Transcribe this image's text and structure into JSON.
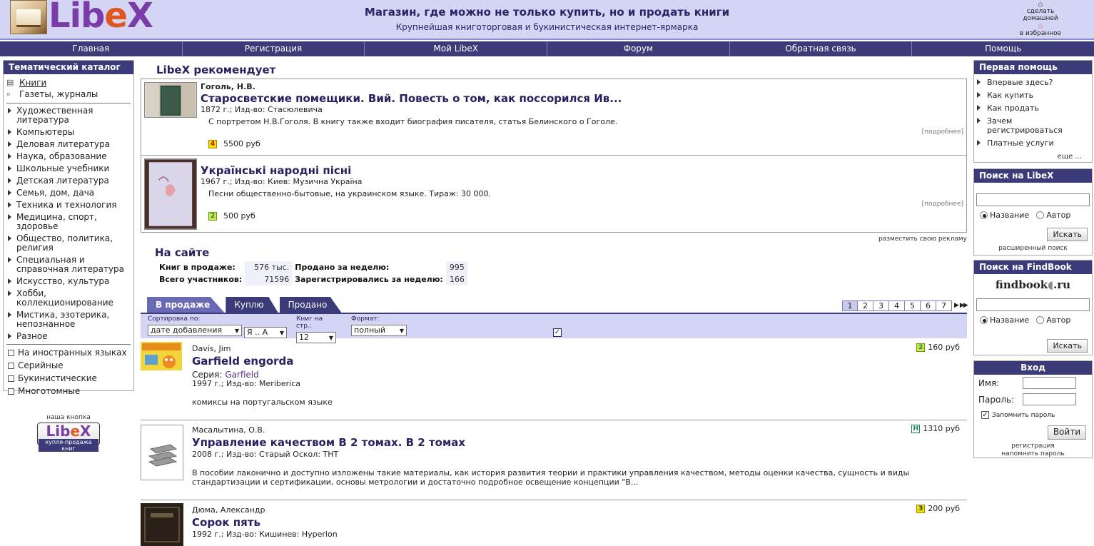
{
  "header": {
    "logo_text": "LibeX",
    "slogan_main": "Магазин, где можно не только купить, но и продать книги",
    "slogan_sub": "Крупнейшая книготорговая и букинистическая интернет-ярмарка",
    "make_home_line1": "сделать",
    "make_home_line2": "домашней",
    "favorites": "в избранное"
  },
  "nav": [
    "Главная",
    "Регистрация",
    "Мой LibeX",
    "Форум",
    "Обратная связь",
    "Помощь"
  ],
  "catalog": {
    "title": "Тематический каталог",
    "top_items": [
      {
        "label": "Книги",
        "icon": "book-icon",
        "selected": true
      },
      {
        "label": "Газеты, журналы",
        "icon": "paperclip-icon",
        "selected": false
      }
    ],
    "categories": [
      "Художественная литература",
      "Компьютеры",
      "Деловая литература",
      "Наука, образование",
      "Школьные учебники",
      "Детская литература",
      "Семья, дом, дача",
      "Техника и технология",
      "Медицина, спорт, здоровье",
      "Общество, политика, религия",
      "Специальная и справочная литература",
      "Искусство, культура",
      "Хобби, коллекционирование",
      "Мистика, эзотерика, непознанное",
      "Разное"
    ],
    "filters": [
      "На иностранных языках",
      "Серийные",
      "Букинистические",
      "Многотомные"
    ]
  },
  "our_button": {
    "caption": "наша кнопка",
    "logo": "LibeX",
    "tagline": "купля-продажа книг"
  },
  "recommend": {
    "title": "LibeX рекомендует",
    "items": [
      {
        "author": "Гоголь, Н.В.",
        "title": "Старосветские помещики. Вий. Повесть о том, как поссорился Ив...",
        "meta": "1872 г.; Изд-во: Стасюлевича",
        "desc": "С портретом Н.В.Гоголя. В книгу также входит биография писателя, статья Белинского о Гоголе.",
        "more": "[подробнее]",
        "grade": "4",
        "price": "5500 руб"
      },
      {
        "author": "",
        "title": "Українські народні пісні",
        "meta": "1967 г.; Изд-во: Киев: Музична Україна",
        "desc": "Песни общественно-бытовые, на украинском языке. Тираж: 30 000.",
        "more": "[подробнее]",
        "grade": "2",
        "price": "500 руб"
      }
    ],
    "ad_link": "разместить свою рекламу"
  },
  "site_stats": {
    "title": "На сайте",
    "rows": [
      {
        "label1": "Книг в продаже:",
        "value1": "576 тыс.",
        "label2": "Продано за неделю:",
        "value2": "995"
      },
      {
        "label1": "Всего участников:",
        "value1": "71596",
        "label2": "Зарегистрировались за неделю:",
        "value2": "166"
      }
    ]
  },
  "tabs": [
    {
      "label": "В продаже",
      "active": true
    },
    {
      "label": "Куплю",
      "active": false
    },
    {
      "label": "Продано",
      "active": false
    }
  ],
  "pager": {
    "pages": [
      "1",
      "2",
      "3",
      "4",
      "5",
      "6",
      "7"
    ],
    "current": "1"
  },
  "sort": {
    "sort_label": "Сортировка по:",
    "sort_value": "дате добавления",
    "order_value": "Я .. А",
    "perpage_label": "Книг на стр.:",
    "perpage_value": "12",
    "format_label": "Формат:",
    "format_value": "полный"
  },
  "listings": [
    {
      "author": "Davis, Jim",
      "title": "Garfield engorda",
      "series_label": "Серия: ",
      "series": "Garfield",
      "meta": "1997 г.; Изд-во: Meriberica",
      "desc": "комиксы на португальском языке",
      "grade": "2",
      "price": "160 руб"
    },
    {
      "author": "Масалытина, О.В.",
      "title": "Управление качеством В 2 томах. В 2 томах",
      "meta": "2008 г.; Изд-во: Старый Оскол: ТНТ",
      "desc": "В пособии лаконично и доступно изложены такие материалы, как история развития теории и практики управления качеством, методы оценки качества, сущность и виды стандартизации и сертификации, основы метрологии и достаточно подробное освещение концепции \"В...",
      "grade": "Н",
      "price": "1310 руб"
    },
    {
      "author": "Дюма, Александр",
      "title": "Сорок пять",
      "meta": "1992 г.; Изд-во: Кишинев: Hyperion",
      "grade": "3",
      "price": "200 руб"
    }
  ],
  "help": {
    "title": "Первая помощь",
    "items": [
      "Впервые здесь?",
      "Как купить",
      "Как продать",
      "Зачем регистрироваться",
      "Платные услуги"
    ],
    "more": "еще ..."
  },
  "search_libex": {
    "title": "Поиск на LibeX",
    "opt_title": "Название",
    "opt_author": "Автор",
    "button": "Искать",
    "advanced": "расширенный поиск"
  },
  "search_findbook": {
    "title": "Поиск на FindBook",
    "logo_left": "findbook",
    "logo_right": ".ru",
    "opt_title": "Название",
    "opt_author": "Автор",
    "button": "Искать"
  },
  "login": {
    "title": "Вход",
    "name_label": "Имя:",
    "pass_label": "Пароль:",
    "remember": "Запомнить пароль",
    "button": "Войти",
    "register": "регистрация",
    "remind": "напомнить пароль"
  }
}
